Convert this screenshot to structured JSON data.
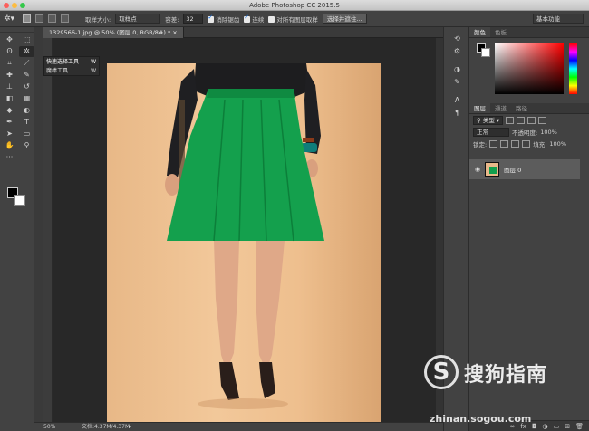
{
  "window": {
    "title": "Adobe Photoshop CC 2015.5"
  },
  "options_bar": {
    "brush_size_label": "取样大小:",
    "sample_select": "取样点",
    "tolerance_label": "容差:",
    "tolerance_value": "32",
    "anti_alias_label": "消除锯齿",
    "contiguous_label": "连续",
    "sample_all_label": "对所有图层取样",
    "select_subject_button": "选择并遮住...",
    "workspace": "基本功能"
  },
  "toolbar": {
    "tools": [
      {
        "name": "move-tool",
        "icon": "✥"
      },
      {
        "name": "marquee-tool",
        "icon": "⬚"
      },
      {
        "name": "lasso-tool",
        "icon": "ʘ"
      },
      {
        "name": "magic-wand-tool",
        "icon": "✲"
      },
      {
        "name": "crop-tool",
        "icon": "⌗"
      },
      {
        "name": "eyedropper-tool",
        "icon": "⟋"
      },
      {
        "name": "healing-tool",
        "icon": "✚"
      },
      {
        "name": "brush-tool",
        "icon": "✎"
      },
      {
        "name": "stamp-tool",
        "icon": "⊥"
      },
      {
        "name": "history-brush-tool",
        "icon": "↺"
      },
      {
        "name": "eraser-tool",
        "icon": "◧"
      },
      {
        "name": "gradient-tool",
        "icon": "▦"
      },
      {
        "name": "blur-tool",
        "icon": "◆"
      },
      {
        "name": "dodge-tool",
        "icon": "◐"
      },
      {
        "name": "pen-tool",
        "icon": "✒"
      },
      {
        "name": "type-tool",
        "icon": "T"
      },
      {
        "name": "path-select-tool",
        "icon": "➤"
      },
      {
        "name": "shape-tool",
        "icon": "▭"
      },
      {
        "name": "hand-tool",
        "icon": "✋"
      },
      {
        "name": "zoom-tool",
        "icon": "⚲"
      },
      {
        "name": "more-tools",
        "icon": "···"
      },
      {
        "name": "edit-toolbar",
        "icon": ""
      }
    ]
  },
  "flyout": {
    "items": [
      {
        "label": "快速选择工具",
        "key": "W"
      },
      {
        "label": "魔棒工具",
        "key": "W"
      }
    ]
  },
  "document": {
    "tab_label": "1329566-1.jpg @ 50% (图层 0, RGB/8#) *"
  },
  "status": {
    "zoom": "50%",
    "doc_size": "文档:4.37M/4.37M"
  },
  "color_panel": {
    "tabs": [
      "颜色",
      "色板"
    ]
  },
  "layers_panel": {
    "tabs": [
      "图层",
      "通道",
      "路径"
    ],
    "filter_label": "类型",
    "blend_mode": "正常",
    "opacity_label": "不透明度:",
    "opacity_value": "100%",
    "lock_label": "锁定:",
    "fill_label": "填充:",
    "fill_value": "100%",
    "layers": [
      {
        "name": "图层 0"
      }
    ]
  },
  "watermark": {
    "logo_char": "S",
    "brand": "搜狗指南",
    "url": "zhinan.sogou.com"
  }
}
